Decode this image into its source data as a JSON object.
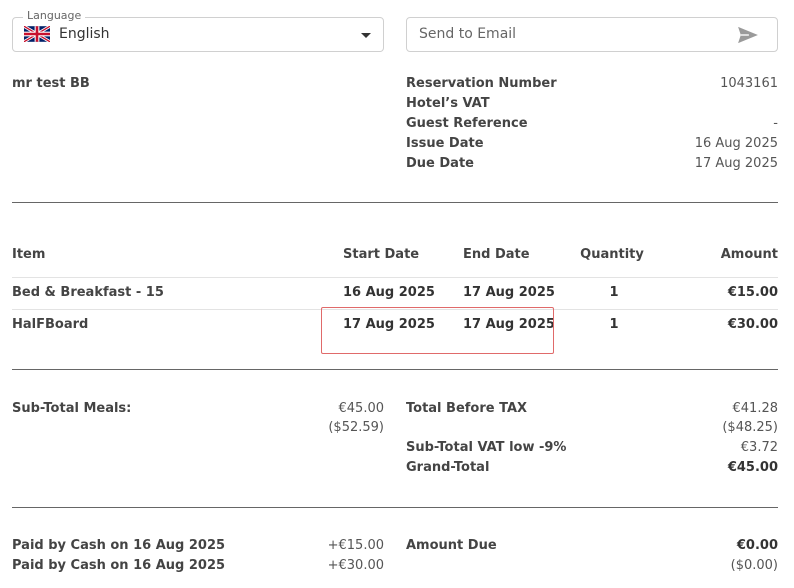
{
  "language": {
    "label": "Language",
    "value": "English",
    "flag_icon": "uk-flag-icon"
  },
  "email": {
    "placeholder": "Send to Email",
    "send_icon": "send-icon"
  },
  "guest": {
    "name": "mr test BB"
  },
  "meta": [
    {
      "label": "Reservation Number",
      "value": "1043161"
    },
    {
      "label": "Hotel’s VAT",
      "value": ""
    },
    {
      "label": "Guest Reference",
      "value": "-"
    },
    {
      "label": "Issue Date",
      "value": "16 Aug 2025"
    },
    {
      "label": "Due Date",
      "value": "17 Aug 2025"
    }
  ],
  "table": {
    "headers": {
      "item": "Item",
      "start": "Start Date",
      "end": "End Date",
      "qty": "Quantity",
      "amount": "Amount"
    },
    "rows": [
      {
        "item": "Bed & Breakfast - 15",
        "start": "16 Aug 2025",
        "end": "17 Aug 2025",
        "qty": "1",
        "amount": "€15.00"
      },
      {
        "item": "HalFBoard",
        "start": "17 Aug 2025",
        "end": "17 Aug 2025",
        "qty": "1",
        "amount": "€30.00"
      }
    ]
  },
  "summary": {
    "meals_label": "Sub-Total Meals:",
    "meals_value": "€45.00",
    "meals_value_alt": "($52.59)",
    "before_tax_label": "Total Before TAX",
    "before_tax_value": "€41.28",
    "before_tax_value_alt": "($48.25)",
    "vat_label": "Sub-Total VAT low -9%",
    "vat_value": "€3.72",
    "grand_label": "Grand-Total",
    "grand_value": "€45.00"
  },
  "payments": {
    "items": [
      {
        "label": "Paid by Cash on 16 Aug 2025",
        "value": "+€15.00"
      },
      {
        "label": "Paid by Cash on 16 Aug 2025",
        "value": "+€30.00"
      }
    ],
    "due_label": "Amount Due",
    "due_value": "€0.00",
    "due_value_alt": "($0.00)"
  },
  "colors": {
    "highlight": "#e06a6a",
    "divider": "#666666"
  }
}
